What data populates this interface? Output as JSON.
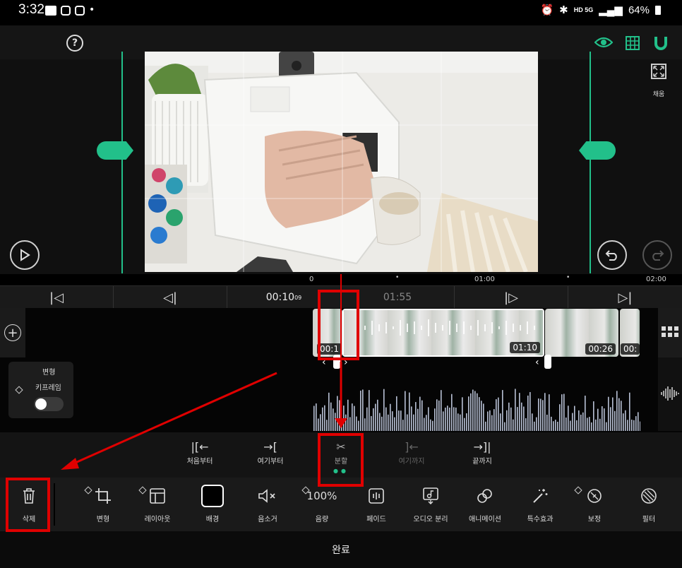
{
  "status_bar": {
    "time": "3:32",
    "network": "HD 5G",
    "battery": "64%"
  },
  "preview": {
    "fill_label": "채움"
  },
  "ruler": {
    "ticks": [
      "0",
      "01:00",
      "02:00"
    ]
  },
  "transport": {
    "current_time": "00:10",
    "current_frames": "09",
    "total_time": "01:55"
  },
  "clips": {
    "first_duration": "00:1",
    "second_duration": "01:10",
    "third_duration": "00:26",
    "fourth_duration": "00:"
  },
  "keyframe_panel": {
    "title": "변형",
    "label": "키프레임"
  },
  "split_bar": {
    "items": [
      {
        "label": "처음부터",
        "enabled": true
      },
      {
        "label": "여기부터",
        "enabled": true
      },
      {
        "label": "분할",
        "enabled": true
      },
      {
        "label": "여기까지",
        "enabled": false
      },
      {
        "label": "끝까지",
        "enabled": true
      }
    ]
  },
  "toolbar": {
    "delete_label": "삭제",
    "items": [
      {
        "label": "변형"
      },
      {
        "label": "레이아웃"
      },
      {
        "label": "배경"
      },
      {
        "label": "음소거"
      },
      {
        "label": "음량",
        "value": "100%"
      },
      {
        "label": "페이드"
      },
      {
        "label": "오디오 분리"
      },
      {
        "label": "애니메이션"
      },
      {
        "label": "특수효과"
      },
      {
        "label": "보정"
      },
      {
        "label": "필터"
      }
    ]
  },
  "bottom": {
    "done_label": "완료"
  },
  "colors": {
    "accent": "#22c08a",
    "highlight": "#e00000",
    "waveform": "#b8c0d4"
  }
}
